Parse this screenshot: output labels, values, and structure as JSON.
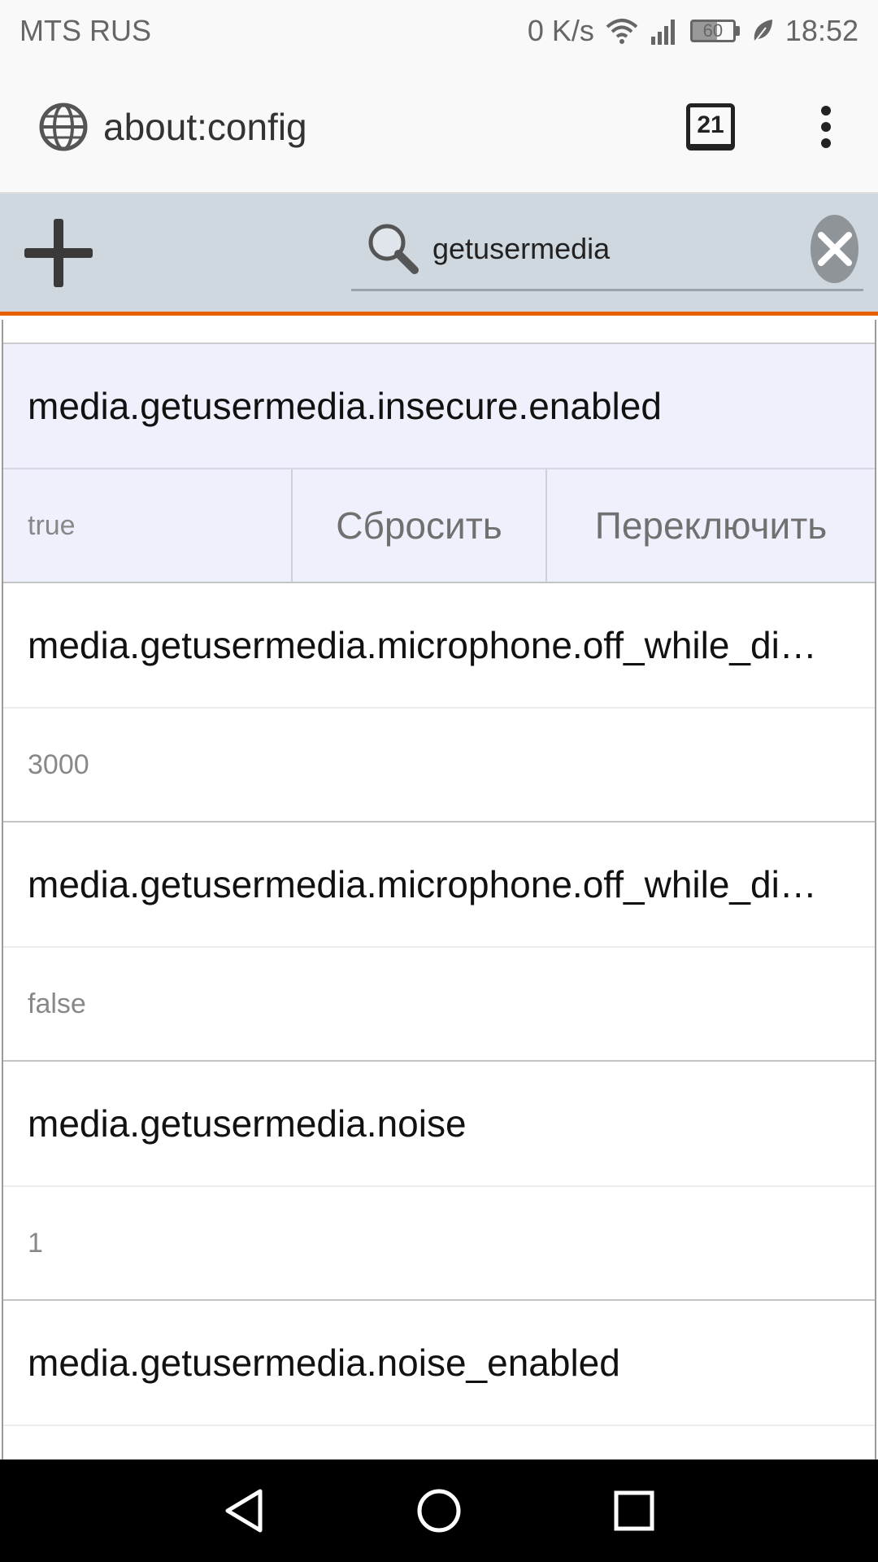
{
  "status_bar": {
    "carrier": "MTS RUS",
    "net_speed": "0 K/s",
    "battery": "60",
    "time": "18:52"
  },
  "browser": {
    "url": "about:config",
    "tab_count": "21"
  },
  "config": {
    "search_value": "getusermedia"
  },
  "prefs": [
    {
      "name": "media.getusermedia.insecure.enabled",
      "value": "true",
      "selected": true
    },
    {
      "name": "media.getusermedia.microphone.off_while_di…",
      "value": "3000"
    },
    {
      "name": "media.getusermedia.microphone.off_while_di…",
      "value": "false"
    },
    {
      "name": "media.getusermedia.noise",
      "value": "1"
    },
    {
      "name": "media.getusermedia.noise_enabled",
      "value": ""
    }
  ],
  "actions": {
    "reset_label": "Сбросить",
    "toggle_label": "Переключить"
  },
  "colors": {
    "accent_orange": "#e66000",
    "config_bar": "#cfd7df",
    "selected_row": "#eef0fc"
  }
}
